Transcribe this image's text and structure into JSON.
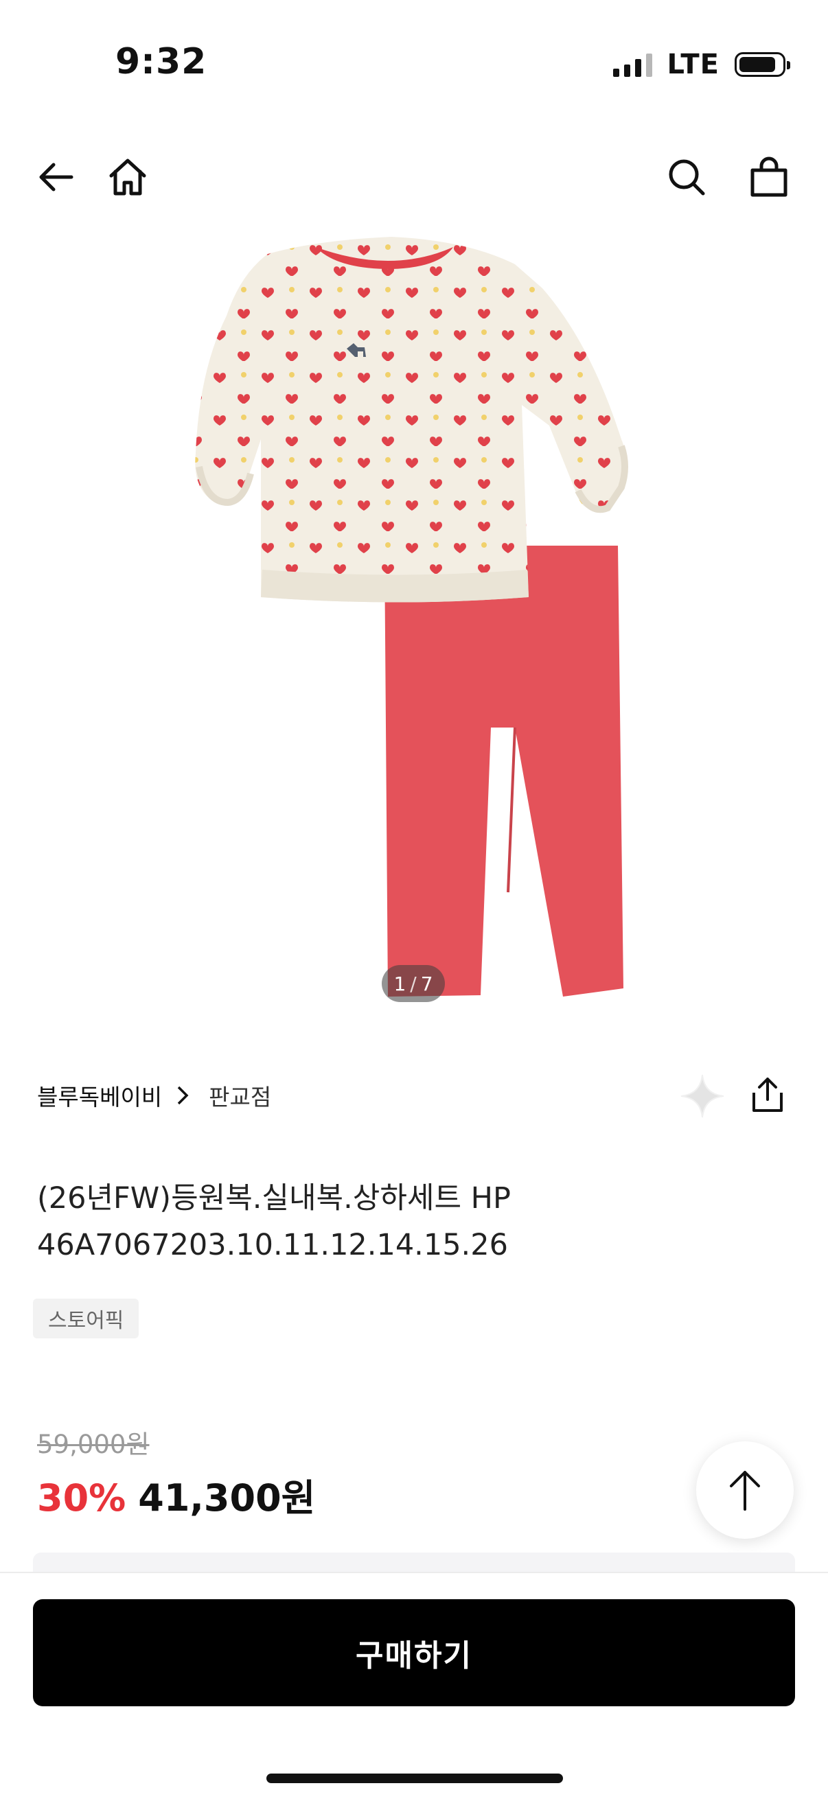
{
  "status_bar": {
    "time": "9:32",
    "network": "LTE"
  },
  "header": {
    "icons": [
      "back-arrow-icon",
      "home-icon",
      "search-icon",
      "shopping-bag-icon"
    ]
  },
  "gallery": {
    "current": "1",
    "total": "7"
  },
  "brand": {
    "name": "블루독베이비",
    "store": "판교점"
  },
  "product": {
    "title_line1": "(26년FW)등원복.실내복.상하세트 HP",
    "title_line2": "46A7067203.10.11.12.14.15.26",
    "tag": "스토어픽"
  },
  "price": {
    "original": "59,000원",
    "discount": "30%",
    "final": "41,300원"
  },
  "actions": {
    "buy_label": "구매하기"
  },
  "colors": {
    "discount": "#e8333a",
    "primary_button": "#000000",
    "pants": "#e4525a",
    "heart": "#e0414a"
  }
}
